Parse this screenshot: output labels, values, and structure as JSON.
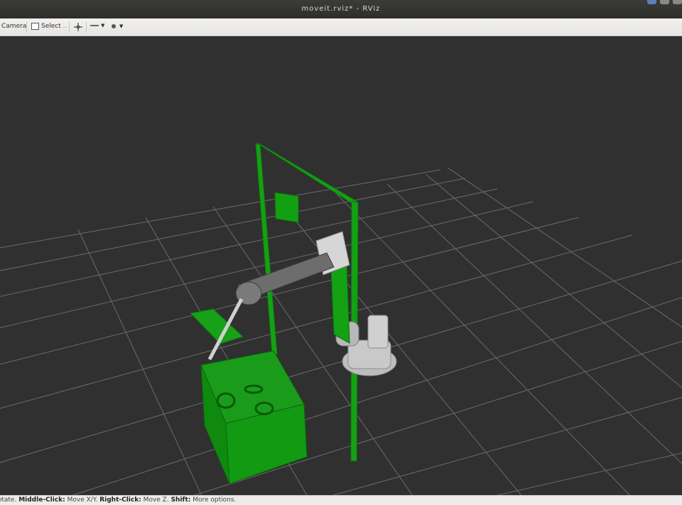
{
  "window": {
    "title": "moveit.rviz* - RViz"
  },
  "toolbar": {
    "items": [
      {
        "label": "Camera",
        "icon": "camera-icon"
      },
      {
        "label": "Select",
        "icon": "select-icon"
      },
      {
        "label": "",
        "icon": "move-camera-icon"
      },
      {
        "label": "",
        "icon": "measure-icon"
      },
      {
        "label": "",
        "icon": "publish-point-icon"
      }
    ]
  },
  "status": {
    "segments": [
      {
        "key": "Rotate.",
        "value": " "
      },
      {
        "key": "Middle-Click:",
        "value": " Move X/Y. "
      },
      {
        "key": "Right-Click:",
        "value": " Move Z. "
      },
      {
        "key": "Shift:",
        "value": " More options."
      }
    ]
  },
  "colors": {
    "scene_green": "#12a112",
    "grid": "#6e6e6e",
    "background": "#303030",
    "robot": "#c8c8c8"
  }
}
